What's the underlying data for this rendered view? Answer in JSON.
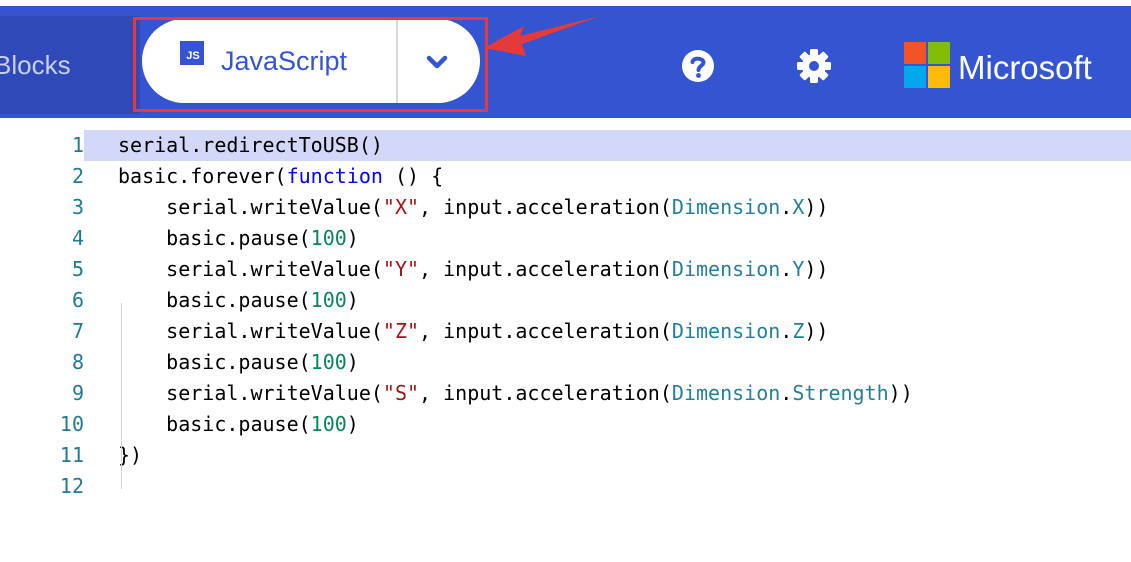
{
  "header": {
    "blocks_tab": "Blocks",
    "editor_mode": {
      "badge": "JS",
      "label": "JavaScript"
    },
    "brand": "Microsoft",
    "colors": {
      "header_bg": "#3454d1",
      "highlight": "#e63a3a"
    },
    "icons": [
      "help-icon",
      "settings-gear-icon",
      "chevron-down-icon",
      "microsoft-logo"
    ]
  },
  "editor": {
    "lines": [
      {
        "n": "1",
        "tokens": [
          {
            "t": "serial.redirectToUSB()",
            "c": "plain"
          }
        ]
      },
      {
        "n": "2",
        "tokens": [
          {
            "t": "basic.forever(",
            "c": "plain"
          },
          {
            "t": "function",
            "c": "kw"
          },
          {
            "t": " () {",
            "c": "plain"
          }
        ]
      },
      {
        "n": "3",
        "tokens": [
          {
            "t": "    serial.writeValue(",
            "c": "plain"
          },
          {
            "t": "\"X\"",
            "c": "str"
          },
          {
            "t": ", input.acceleration(",
            "c": "plain"
          },
          {
            "t": "Dimension",
            "c": "typ"
          },
          {
            "t": ".",
            "c": "plain"
          },
          {
            "t": "X",
            "c": "typ"
          },
          {
            "t": "))",
            "c": "plain"
          }
        ]
      },
      {
        "n": "4",
        "tokens": [
          {
            "t": "    basic.pause(",
            "c": "plain"
          },
          {
            "t": "100",
            "c": "num"
          },
          {
            "t": ")",
            "c": "plain"
          }
        ]
      },
      {
        "n": "5",
        "tokens": [
          {
            "t": "    serial.writeValue(",
            "c": "plain"
          },
          {
            "t": "\"Y\"",
            "c": "str"
          },
          {
            "t": ", input.acceleration(",
            "c": "plain"
          },
          {
            "t": "Dimension",
            "c": "typ"
          },
          {
            "t": ".",
            "c": "plain"
          },
          {
            "t": "Y",
            "c": "typ"
          },
          {
            "t": "))",
            "c": "plain"
          }
        ]
      },
      {
        "n": "6",
        "tokens": [
          {
            "t": "    basic.pause(",
            "c": "plain"
          },
          {
            "t": "100",
            "c": "num"
          },
          {
            "t": ")",
            "c": "plain"
          }
        ]
      },
      {
        "n": "7",
        "tokens": [
          {
            "t": "    serial.writeValue(",
            "c": "plain"
          },
          {
            "t": "\"Z\"",
            "c": "str"
          },
          {
            "t": ", input.acceleration(",
            "c": "plain"
          },
          {
            "t": "Dimension",
            "c": "typ"
          },
          {
            "t": ".",
            "c": "plain"
          },
          {
            "t": "Z",
            "c": "typ"
          },
          {
            "t": "))",
            "c": "plain"
          }
        ]
      },
      {
        "n": "8",
        "tokens": [
          {
            "t": "    basic.pause(",
            "c": "plain"
          },
          {
            "t": "100",
            "c": "num"
          },
          {
            "t": ")",
            "c": "plain"
          }
        ]
      },
      {
        "n": "9",
        "tokens": [
          {
            "t": "    serial.writeValue(",
            "c": "plain"
          },
          {
            "t": "\"S\"",
            "c": "str"
          },
          {
            "t": ", input.acceleration(",
            "c": "plain"
          },
          {
            "t": "Dimension",
            "c": "typ"
          },
          {
            "t": ".",
            "c": "plain"
          },
          {
            "t": "Strength",
            "c": "typ"
          },
          {
            "t": "))",
            "c": "plain"
          }
        ]
      },
      {
        "n": "10",
        "tokens": [
          {
            "t": "    basic.pause(",
            "c": "plain"
          },
          {
            "t": "100",
            "c": "num"
          },
          {
            "t": ")",
            "c": "plain"
          }
        ]
      },
      {
        "n": "11",
        "tokens": [
          {
            "t": "})",
            "c": "plain"
          }
        ]
      },
      {
        "n": "12",
        "tokens": []
      }
    ]
  }
}
